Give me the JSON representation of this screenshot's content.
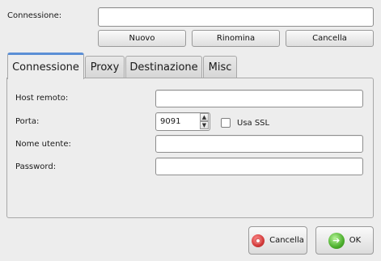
{
  "connection": {
    "label": "Connessione:",
    "value": "",
    "buttons": {
      "new": "Nuovo",
      "rename": "Rinomina",
      "delete": "Cancella"
    }
  },
  "tabs": [
    {
      "label": "Connessione",
      "active": true
    },
    {
      "label": "Proxy",
      "active": false
    },
    {
      "label": "Destinazione",
      "active": false
    },
    {
      "label": "Misc",
      "active": false
    }
  ],
  "form": {
    "host_label": "Host remoto:",
    "host_value": "",
    "port_label": "Porta:",
    "port_value": "9091",
    "ssl_label": "Usa SSL",
    "ssl_checked": false,
    "user_label": "Nome utente:",
    "user_value": "",
    "password_label": "Password:",
    "password_value": ""
  },
  "footer": {
    "cancel": "Cancella",
    "ok": "OK"
  },
  "colors": {
    "tab_accent": "#5b8fd6",
    "cancel_icon": "#d23b3b",
    "ok_icon": "#4caf2d"
  }
}
